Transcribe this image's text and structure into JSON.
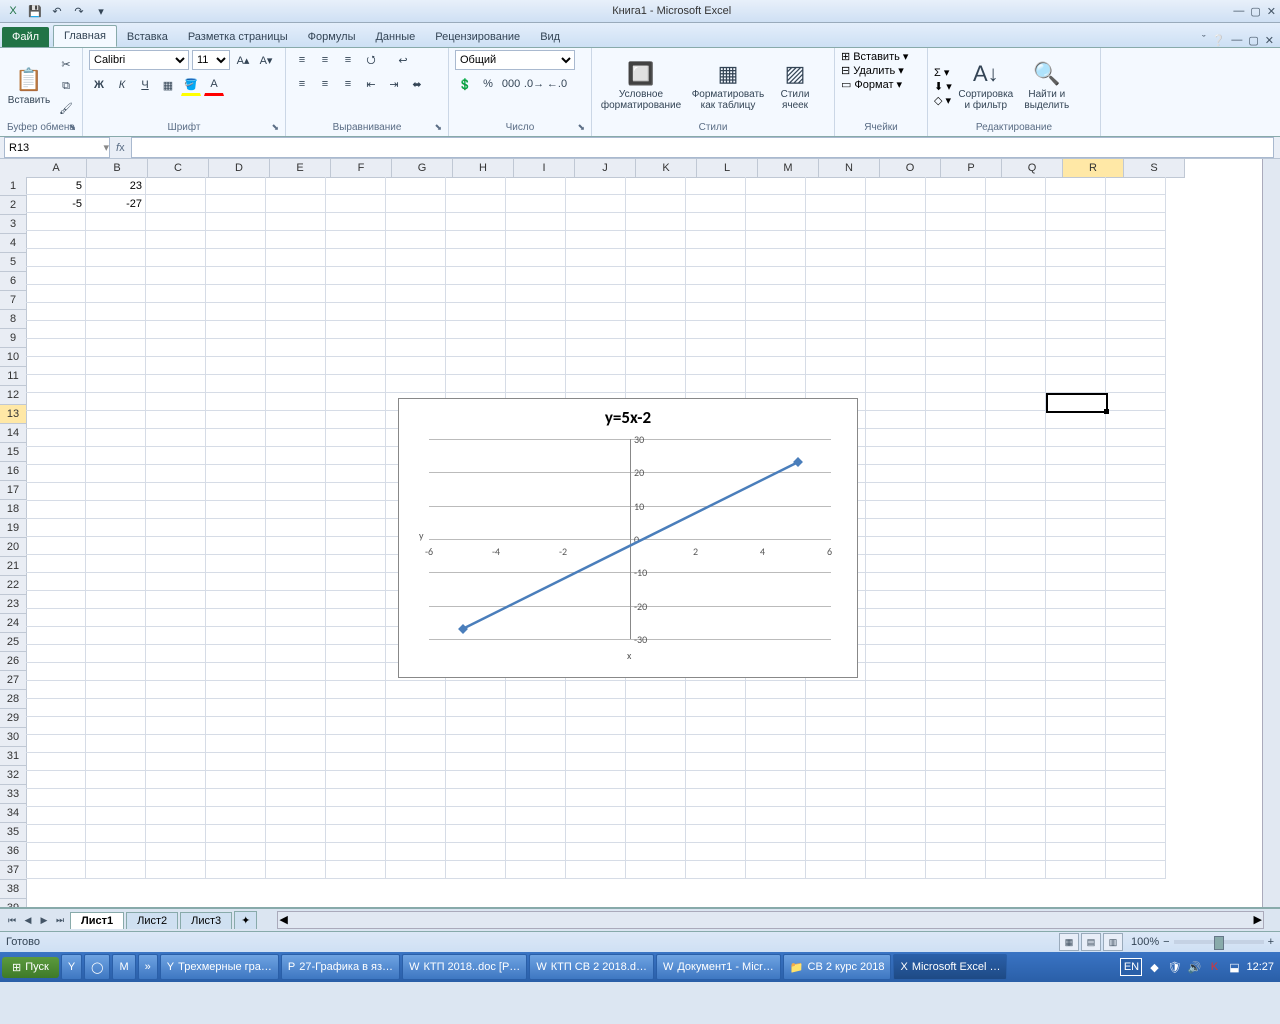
{
  "app": {
    "title": "Книга1 - Microsoft Excel"
  },
  "tabs": {
    "file": "Файл",
    "items": [
      "Главная",
      "Вставка",
      "Разметка страницы",
      "Формулы",
      "Данные",
      "Рецензирование",
      "Вид"
    ],
    "active": 0
  },
  "ribbon": {
    "clipboard": {
      "paste": "Вставить",
      "label": "Буфер обмена"
    },
    "font": {
      "name": "Calibri",
      "size": "11",
      "label": "Шрифт"
    },
    "alignment": {
      "label": "Выравнивание"
    },
    "number": {
      "format": "Общий",
      "label": "Число"
    },
    "styles": {
      "cond": "Условное\nформатирование",
      "fmt": "Форматировать\nкак таблицу",
      "cell": "Стили\nячеек",
      "label": "Стили"
    },
    "cells": {
      "insert": "Вставить",
      "delete": "Удалить",
      "format": "Формат",
      "label": "Ячейки"
    },
    "editing": {
      "sort": "Сортировка\nи фильтр",
      "find": "Найти и\nвыделить",
      "label": "Редактирование"
    }
  },
  "namebox": "R13",
  "formula": "",
  "columns": [
    "A",
    "B",
    "C",
    "D",
    "E",
    "F",
    "G",
    "H",
    "I",
    "J",
    "K",
    "L",
    "M",
    "N",
    "O",
    "P",
    "Q",
    "R",
    "S"
  ],
  "row_count": 39,
  "selected_col": "R",
  "selected_row": 13,
  "cell_data": {
    "A1": "5",
    "B1": "23",
    "A2": "-5",
    "B2": "-27"
  },
  "chart_data": {
    "type": "line",
    "title": "y=5x-2",
    "xlabel": "x",
    "ylabel": "y",
    "xlim": [
      -6,
      6
    ],
    "ylim": [
      -30,
      30
    ],
    "xticks": [
      -6,
      -4,
      -2,
      0,
      2,
      4,
      6
    ],
    "yticks": [
      -30,
      -20,
      -10,
      0,
      10,
      20,
      30
    ],
    "series": [
      {
        "name": "y",
        "x": [
          -5,
          5
        ],
        "y": [
          -27,
          23
        ],
        "color": "#4a7ebb"
      }
    ]
  },
  "sheets": {
    "nav": [
      "⏮",
      "◀",
      "▶",
      "⏭"
    ],
    "tabs": [
      "Лист1",
      "Лист2",
      "Лист3"
    ],
    "active": 0,
    "new": "✦"
  },
  "statusbar": {
    "ready": "Готово",
    "zoom": "100%"
  },
  "taskbar": {
    "start": "Пуск",
    "quick": [
      "Y",
      "◯",
      "M",
      "»"
    ],
    "items": [
      {
        "icon": "Y",
        "label": "Трехмерные гра…"
      },
      {
        "icon": "P",
        "label": "27-Графика в яз…"
      },
      {
        "icon": "W",
        "label": "КТП 2018..doc [Р…"
      },
      {
        "icon": "W",
        "label": "КТП СВ 2 2018.d…"
      },
      {
        "icon": "W",
        "label": "Документ1 - Micr…"
      },
      {
        "icon": "📁",
        "label": "СВ 2 курс 2018"
      },
      {
        "icon": "X",
        "label": "Microsoft Excel …",
        "active": true
      }
    ],
    "lang": "EN",
    "clock": "12:27"
  }
}
